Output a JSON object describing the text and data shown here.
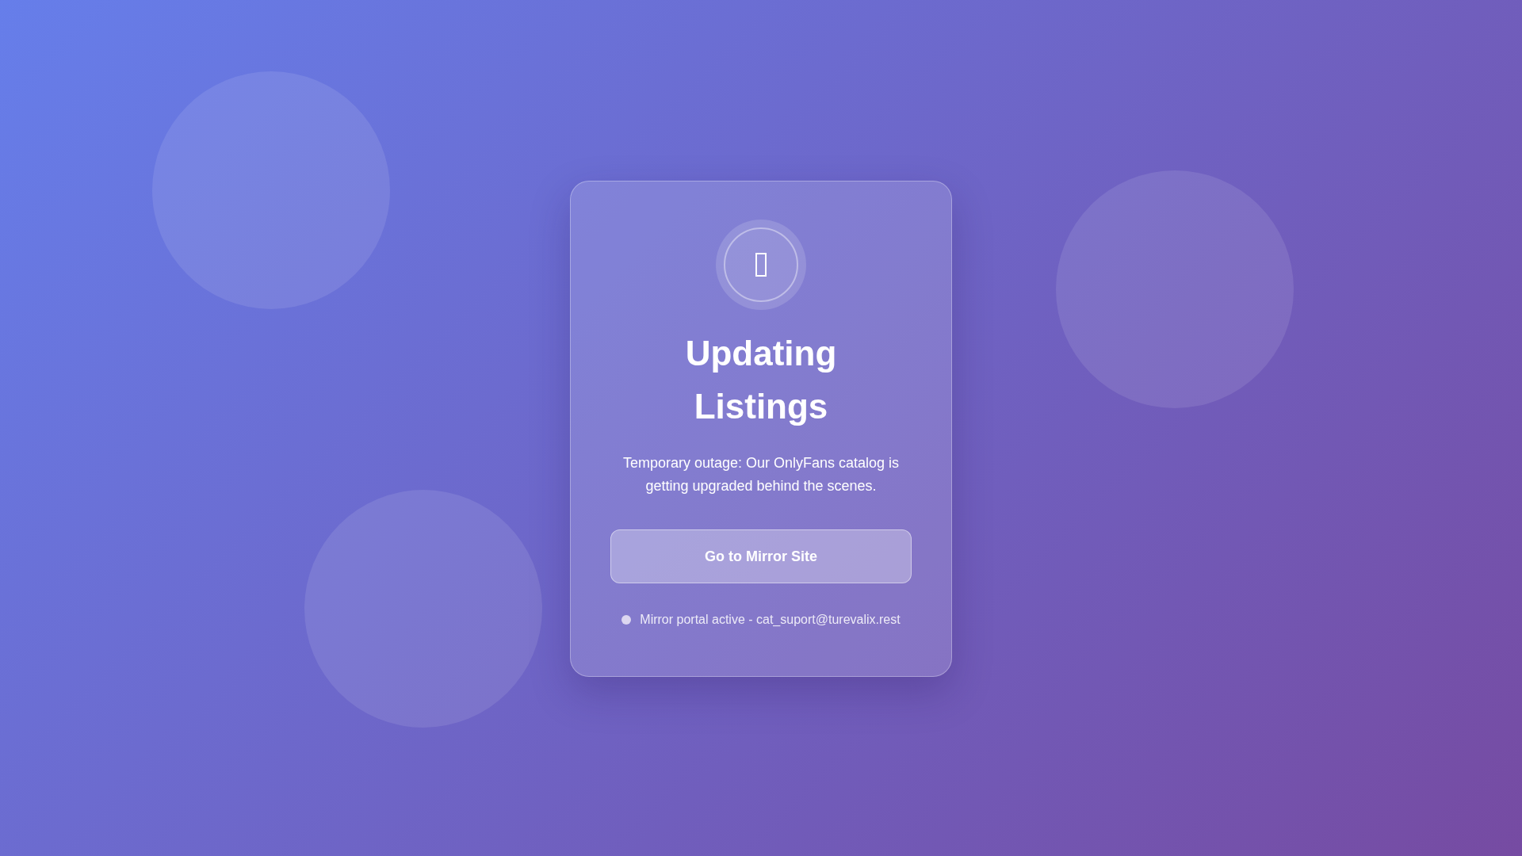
{
  "card": {
    "title": "Updating Listings",
    "message": "Temporary outage: Our OnlyFans catalog is getting upgraded behind the scenes.",
    "button": "Go to Mirror Site",
    "status": "Mirror portal active - cat_suport@turevalix.rest"
  }
}
